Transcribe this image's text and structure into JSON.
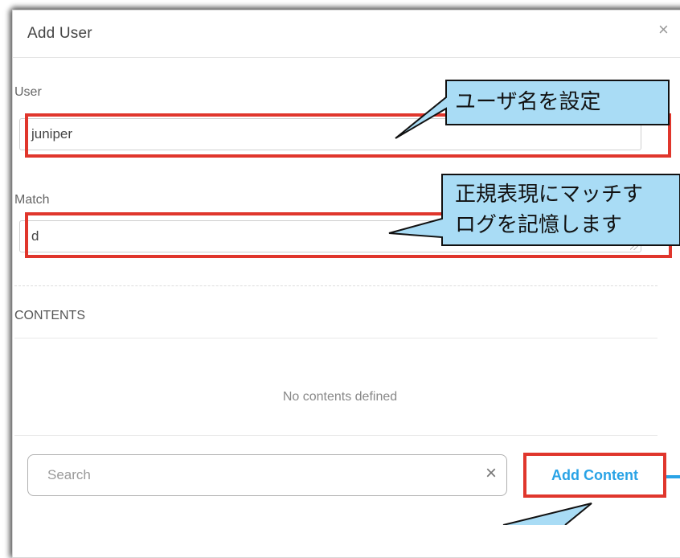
{
  "dialog": {
    "title": "Add User",
    "close_icon": "close-icon"
  },
  "user_field": {
    "label": "User",
    "value": "juniper"
  },
  "match_field": {
    "label": "Match",
    "value": "d"
  },
  "contents": {
    "section_title": "CONTENTS",
    "empty_message": "No contents defined"
  },
  "search": {
    "placeholder": "Search"
  },
  "add_content": {
    "label": "Add Content"
  },
  "annotations": {
    "callout_user": "ユーザ名を設定",
    "callout_match_line1": "正規表現にマッチす",
    "callout_match_line2": "ログを記憶します"
  },
  "colors": {
    "highlight_red": "#e0362c",
    "callout_fill": "#a9dcf5",
    "link_blue": "#29a3e6"
  }
}
